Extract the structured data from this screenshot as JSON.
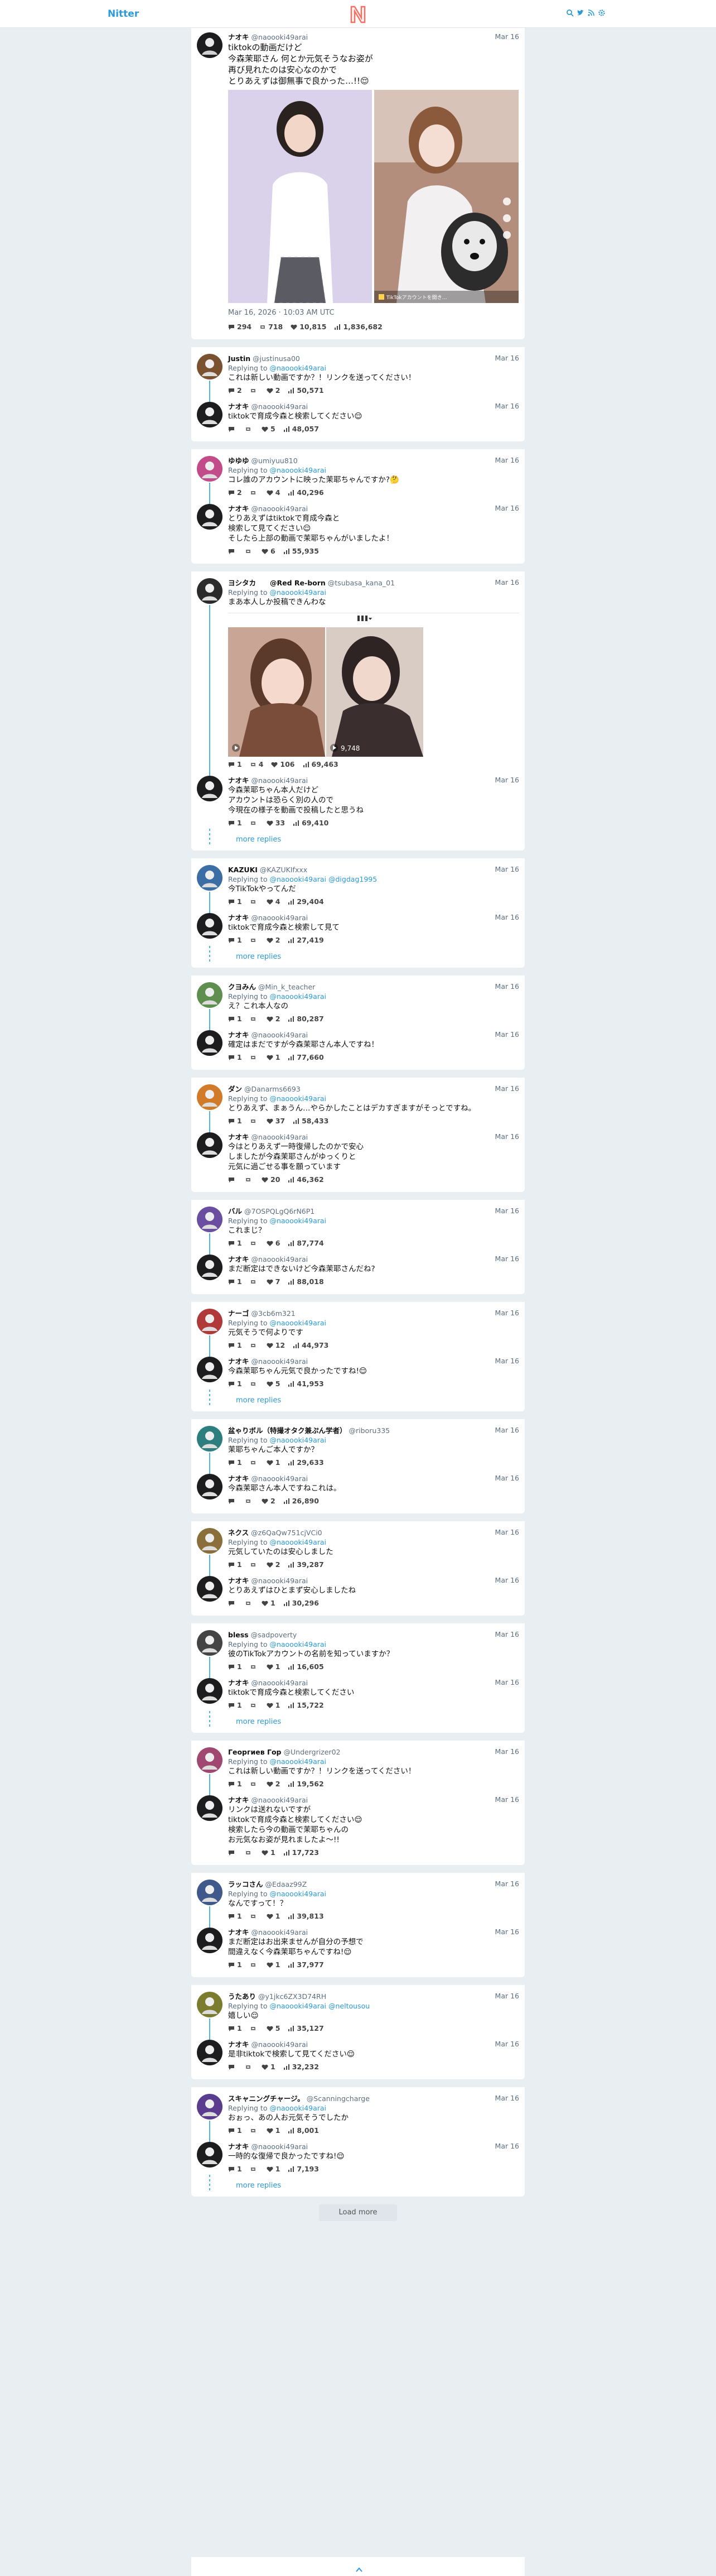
{
  "nav": {
    "brand": "Nitter",
    "icons": [
      "search-icon",
      "twitter-icon",
      "rss-icon",
      "settings-icon"
    ]
  },
  "colors": {
    "accent": "#2b9ad9",
    "thread_line": "#4db4e6",
    "background": "#e9eef2",
    "logo": "#ff6c60"
  },
  "main": {
    "name": "ナオキ",
    "user": "@naoooki49arai",
    "date": "Mar 16",
    "text": "tiktokの動画だけど\n今森茉耶さん 何とか元気そうなお姿が\n再び見れたのは安心なのかで\nとりあえずは御無事で良かった…!!😌",
    "full_date": "Mar 16, 2026 · 10:03 AM UTC",
    "stats": [
      "294",
      "718",
      "10,815",
      "1,836,682"
    ],
    "video_overlay": "TikTokアカウントを開き…"
  },
  "threads": [
    {
      "tweets": [
        {
          "name": "Justin",
          "user": "@justinusa00",
          "date": "Mar 16",
          "reply_prefix": "Replying to ",
          "reply_to": "@naoooki49arai",
          "text": "これは新しい動画ですか？！リンクを送ってください！",
          "stats": [
            "2",
            "",
            "2",
            "50,571"
          ]
        },
        {
          "name": "ナオキ",
          "user": "@naoooki49arai",
          "date": "Mar 16",
          "reply_prefix": "",
          "reply_to": "",
          "text": "tiktokで育成今森と検索してください😌",
          "stats": [
            "",
            "",
            "5",
            "48,057"
          ]
        }
      ],
      "more": ""
    },
    {
      "tweets": [
        {
          "name": "ゆゆゆ",
          "user": "@umiyuu810",
          "date": "Mar 16",
          "reply_prefix": "Replying to ",
          "reply_to": "@naoooki49arai",
          "text": "コレ誰のアカウントに映った茉耶ちゃんですか?🤔",
          "stats": [
            "2",
            "",
            "4",
            "40,296"
          ]
        },
        {
          "name": "ナオキ",
          "user": "@naoooki49arai",
          "date": "Mar 16",
          "reply_prefix": "",
          "reply_to": "",
          "text": "とりあえずはtiktokで育成今森と\n検索して見てください😌\nそしたら上部の動画で茉耶ちゃんがいましたよ！",
          "stats": [
            "",
            "",
            "6",
            "55,935"
          ]
        }
      ],
      "more": ""
    },
    {
      "tweets": [
        {
          "name": "ヨシタカ　　@Red Re-born",
          "user": "@tsubasa_kana_01",
          "date": "Mar 16",
          "reply_prefix": "Replying to ",
          "reply_to": "@naoooki49arai",
          "text": "まあ本人しか投稿できんわな",
          "stats": [
            "1",
            "4",
            "106",
            "69,463"
          ],
          "media": true,
          "quote_views": "9,748"
        },
        {
          "name": "ナオキ",
          "user": "@naoooki49arai",
          "date": "Mar 16",
          "reply_prefix": "",
          "reply_to": "",
          "text": "今森茉耶ちゃん本人だけど\nアカウントは恐らく別の人ので\n今現在の様子を動画で投稿したと思うね",
          "stats": [
            "1",
            "",
            "33",
            "69,410"
          ]
        }
      ],
      "more": "more replies"
    },
    {
      "tweets": [
        {
          "name": "KAZUKI",
          "user": "@KAZUKIfxxx",
          "date": "Mar 16",
          "reply_prefix": "Replying to ",
          "reply_to": "@naoooki49arai @digdag1995",
          "text": "今TikTokやってんだ",
          "stats": [
            "1",
            "",
            "4",
            "29,404"
          ]
        },
        {
          "name": "ナオキ",
          "user": "@naoooki49arai",
          "date": "Mar 16",
          "reply_prefix": "",
          "reply_to": "",
          "text": "tiktokで育成今森と検索して見て",
          "stats": [
            "1",
            "",
            "2",
            "27,419"
          ]
        }
      ],
      "more": "more replies"
    },
    {
      "tweets": [
        {
          "name": "クヨみん",
          "user": "@Min_k_teacher",
          "date": "Mar 16",
          "reply_prefix": "Replying to ",
          "reply_to": "@naoooki49arai",
          "text": "え？これ本人なの",
          "stats": [
            "1",
            "",
            "2",
            "80,287"
          ]
        },
        {
          "name": "ナオキ",
          "user": "@naoooki49arai",
          "date": "Mar 16",
          "reply_prefix": "",
          "reply_to": "",
          "text": "確定はまだですが今森茉耶さん本人ですね！",
          "stats": [
            "1",
            "",
            "1",
            "77,660"
          ]
        }
      ],
      "more": ""
    },
    {
      "tweets": [
        {
          "name": "ダン",
          "user": "@Danarms6693",
          "date": "Mar 16",
          "reply_prefix": "Replying to ",
          "reply_to": "@naoooki49arai",
          "text": "とりあえず、まぁうん…やらかしたことはデカすぎますがそっとですね。",
          "stats": [
            "1",
            "",
            "37",
            "58,433"
          ]
        },
        {
          "name": "ナオキ",
          "user": "@naoooki49arai",
          "date": "Mar 16",
          "reply_prefix": "",
          "reply_to": "",
          "text": "今はとりあえず一時復帰したのかで安心\nしましたが今森茉耶さんがゆっくりと\n元気に過ごせる事を願っています",
          "stats": [
            "",
            "",
            "20",
            "46,362"
          ]
        }
      ],
      "more": ""
    },
    {
      "tweets": [
        {
          "name": "バル",
          "user": "@7OSPQLgQ6rN6P1",
          "date": "Mar 16",
          "reply_prefix": "Replying to ",
          "reply_to": "@naoooki49arai",
          "text": "これまじ？",
          "stats": [
            "1",
            "",
            "6",
            "87,774"
          ]
        },
        {
          "name": "ナオキ",
          "user": "@naoooki49arai",
          "date": "Mar 16",
          "reply_prefix": "",
          "reply_to": "",
          "text": "まだ断定はできないけど今森茉耶さんだね?",
          "stats": [
            "1",
            "",
            "7",
            "88,018"
          ]
        }
      ],
      "more": ""
    },
    {
      "tweets": [
        {
          "name": "ナーゴ",
          "user": "@3cb6m321",
          "date": "Mar 16",
          "reply_prefix": "Replying to ",
          "reply_to": "@naoooki49arai",
          "text": "元気そうで何よりです",
          "stats": [
            "1",
            "",
            "12",
            "44,973"
          ]
        },
        {
          "name": "ナオキ",
          "user": "@naoooki49arai",
          "date": "Mar 16",
          "reply_prefix": "",
          "reply_to": "",
          "text": "今森茉耶ちゃん元気で良かったですね!😌",
          "stats": [
            "1",
            "",
            "5",
            "41,953"
          ]
        }
      ],
      "more": "more replies"
    },
    {
      "tweets": [
        {
          "name": "盆ゃりボル（特撮オタク兼ぷん学者）",
          "user": "@riboru335",
          "date": "Mar 16",
          "reply_prefix": "Replying to ",
          "reply_to": "@naoooki49arai",
          "text": "茉耶ちゃんご本人ですか？",
          "stats": [
            "1",
            "",
            "1",
            "29,633"
          ]
        },
        {
          "name": "ナオキ",
          "user": "@naoooki49arai",
          "date": "Mar 16",
          "reply_prefix": "",
          "reply_to": "",
          "text": "今森茉耶さん本人ですねこれは。",
          "stats": [
            "",
            "",
            "2",
            "26,890"
          ]
        }
      ],
      "more": ""
    },
    {
      "tweets": [
        {
          "name": "ネクス",
          "user": "@z6QaQw751cjVCi0",
          "date": "Mar 16",
          "reply_prefix": "Replying to ",
          "reply_to": "@naoooki49arai",
          "text": "元気していたのは安心しました",
          "stats": [
            "1",
            "",
            "2",
            "39,287"
          ]
        },
        {
          "name": "ナオキ",
          "user": "@naoooki49arai",
          "date": "Mar 16",
          "reply_prefix": "",
          "reply_to": "",
          "text": "とりあえずはひとまず安心しましたね",
          "stats": [
            "",
            "",
            "1",
            "30,296"
          ]
        }
      ],
      "more": ""
    },
    {
      "tweets": [
        {
          "name": "bless",
          "user": "@sadpoverty",
          "date": "Mar 16",
          "reply_prefix": "Replying to ",
          "reply_to": "@naoooki49arai",
          "text": "彼のTikTokアカウントの名前を知っていますか？",
          "stats": [
            "1",
            "",
            "1",
            "16,605"
          ]
        },
        {
          "name": "ナオキ",
          "user": "@naoooki49arai",
          "date": "Mar 16",
          "reply_prefix": "",
          "reply_to": "",
          "text": "tiktokで育成今森と検索してください",
          "stats": [
            "1",
            "",
            "1",
            "15,722"
          ]
        }
      ],
      "more": "more replies"
    },
    {
      "tweets": [
        {
          "name": "Георгиев Гор",
          "user": "@Undergrizer02",
          "date": "Mar 16",
          "reply_prefix": "Replying to ",
          "reply_to": "@naoooki49arai",
          "text": "これは新しい動画ですか？！リンクを送ってください！",
          "stats": [
            "1",
            "",
            "2",
            "19,562"
          ]
        },
        {
          "name": "ナオキ",
          "user": "@naoooki49arai",
          "date": "Mar 16",
          "reply_prefix": "",
          "reply_to": "",
          "text": "リンクは送れないですが\ntiktokで育成今森と検索してください😌\n検索したら今の動画で茉耶ちゃんの\nお元気なお姿が見れましたよ～!!",
          "stats": [
            "",
            "",
            "1",
            "17,723"
          ]
        }
      ],
      "more": ""
    },
    {
      "tweets": [
        {
          "name": "ラッコさん",
          "user": "@Edaaz99Z",
          "date": "Mar 16",
          "reply_prefix": "Replying to ",
          "reply_to": "@naoooki49arai",
          "text": "なんですって！？",
          "stats": [
            "1",
            "",
            "1",
            "39,813"
          ]
        },
        {
          "name": "ナオキ",
          "user": "@naoooki49arai",
          "date": "Mar 16",
          "reply_prefix": "",
          "reply_to": "",
          "text": "まだ断定はお出来ませんが自分の予想で\n間違えなく今森茉耶ちゃんですね!😌",
          "stats": [
            "1",
            "",
            "1",
            "37,977"
          ]
        }
      ],
      "more": ""
    },
    {
      "tweets": [
        {
          "name": "うたあり",
          "user": "@y1jkc6ZX3D74RH",
          "date": "Mar 16",
          "reply_prefix": "Replying to ",
          "reply_to": "@naoooki49arai @neltousou",
          "text": "嬉しい😌",
          "stats": [
            "1",
            "",
            "5",
            "35,127"
          ]
        },
        {
          "name": "ナオキ",
          "user": "@naoooki49arai",
          "date": "Mar 16",
          "reply_prefix": "",
          "reply_to": "",
          "text": "是非tiktokで検索して見てください😌",
          "stats": [
            "",
            "",
            "1",
            "32,232"
          ]
        }
      ],
      "more": ""
    },
    {
      "tweets": [
        {
          "name": "スキャニングチャージ。",
          "user": "@Scanningcharge",
          "date": "Mar 16",
          "reply_prefix": "Replying to ",
          "reply_to": "@naoooki49arai",
          "text": "おぉっ、あの人お元気そうでしたか",
          "stats": [
            "1",
            "",
            "1",
            "8,001"
          ]
        },
        {
          "name": "ナオキ",
          "user": "@naoooki49arai",
          "date": "Mar 16",
          "reply_prefix": "",
          "reply_to": "",
          "text": "一時的な復帰で良かったですね!😌",
          "stats": [
            "1",
            "",
            "1",
            "7,193"
          ]
        }
      ],
      "more": "more replies"
    }
  ],
  "load_more": "Load more"
}
